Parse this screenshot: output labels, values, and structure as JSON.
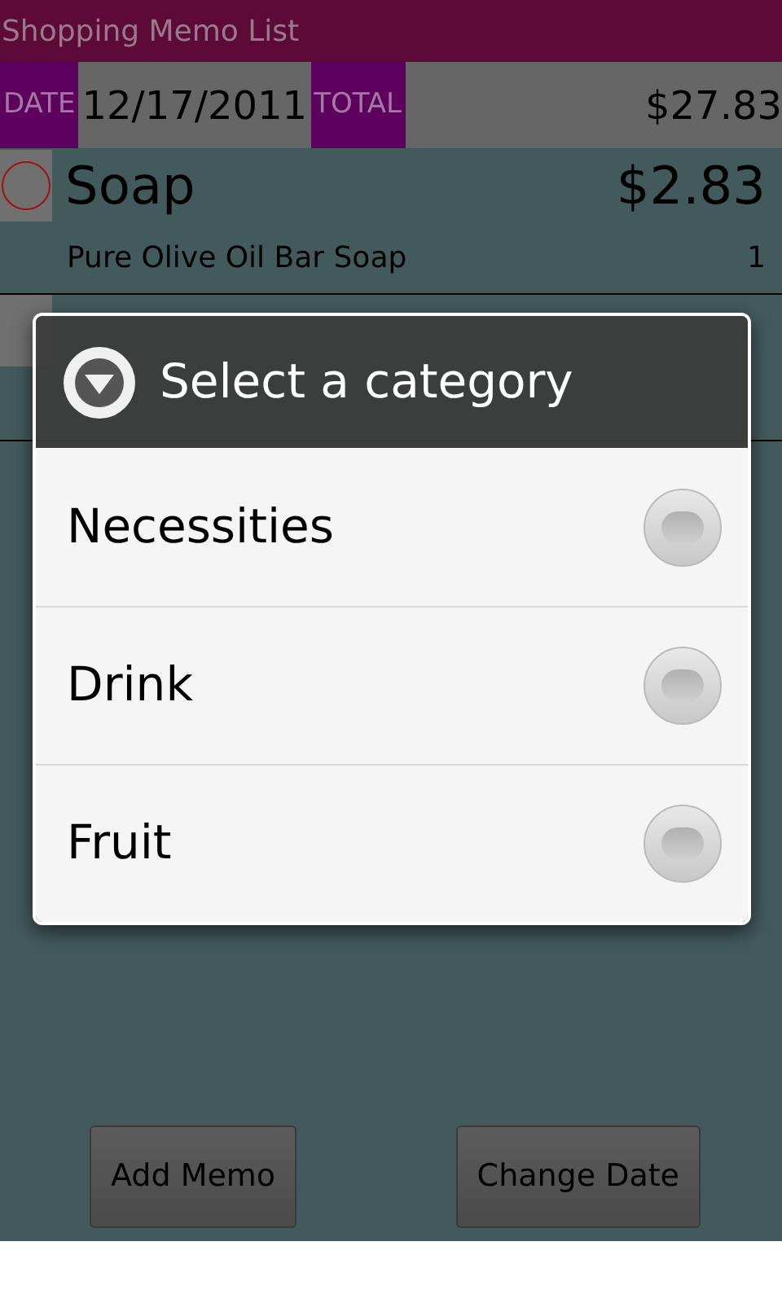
{
  "title_bar": {
    "title": "Shopping Memo List"
  },
  "summary": {
    "date_label": "DATE",
    "date": "12/17/2011",
    "total_label": "TOTAL",
    "total": "$27.83"
  },
  "items": [
    {
      "name": "Soap",
      "price": "$2.83",
      "description": "Pure Olive Oil Bar Soap",
      "quantity": "1",
      "checked": false
    }
  ],
  "buttons": [
    "Add Memo",
    "Change Date"
  ],
  "dialog": {
    "title": "Select a category",
    "options": [
      {
        "label": "Necessities",
        "selected": false
      },
      {
        "label": "Drink",
        "selected": false
      },
      {
        "label": "Fruit",
        "selected": false
      }
    ]
  }
}
